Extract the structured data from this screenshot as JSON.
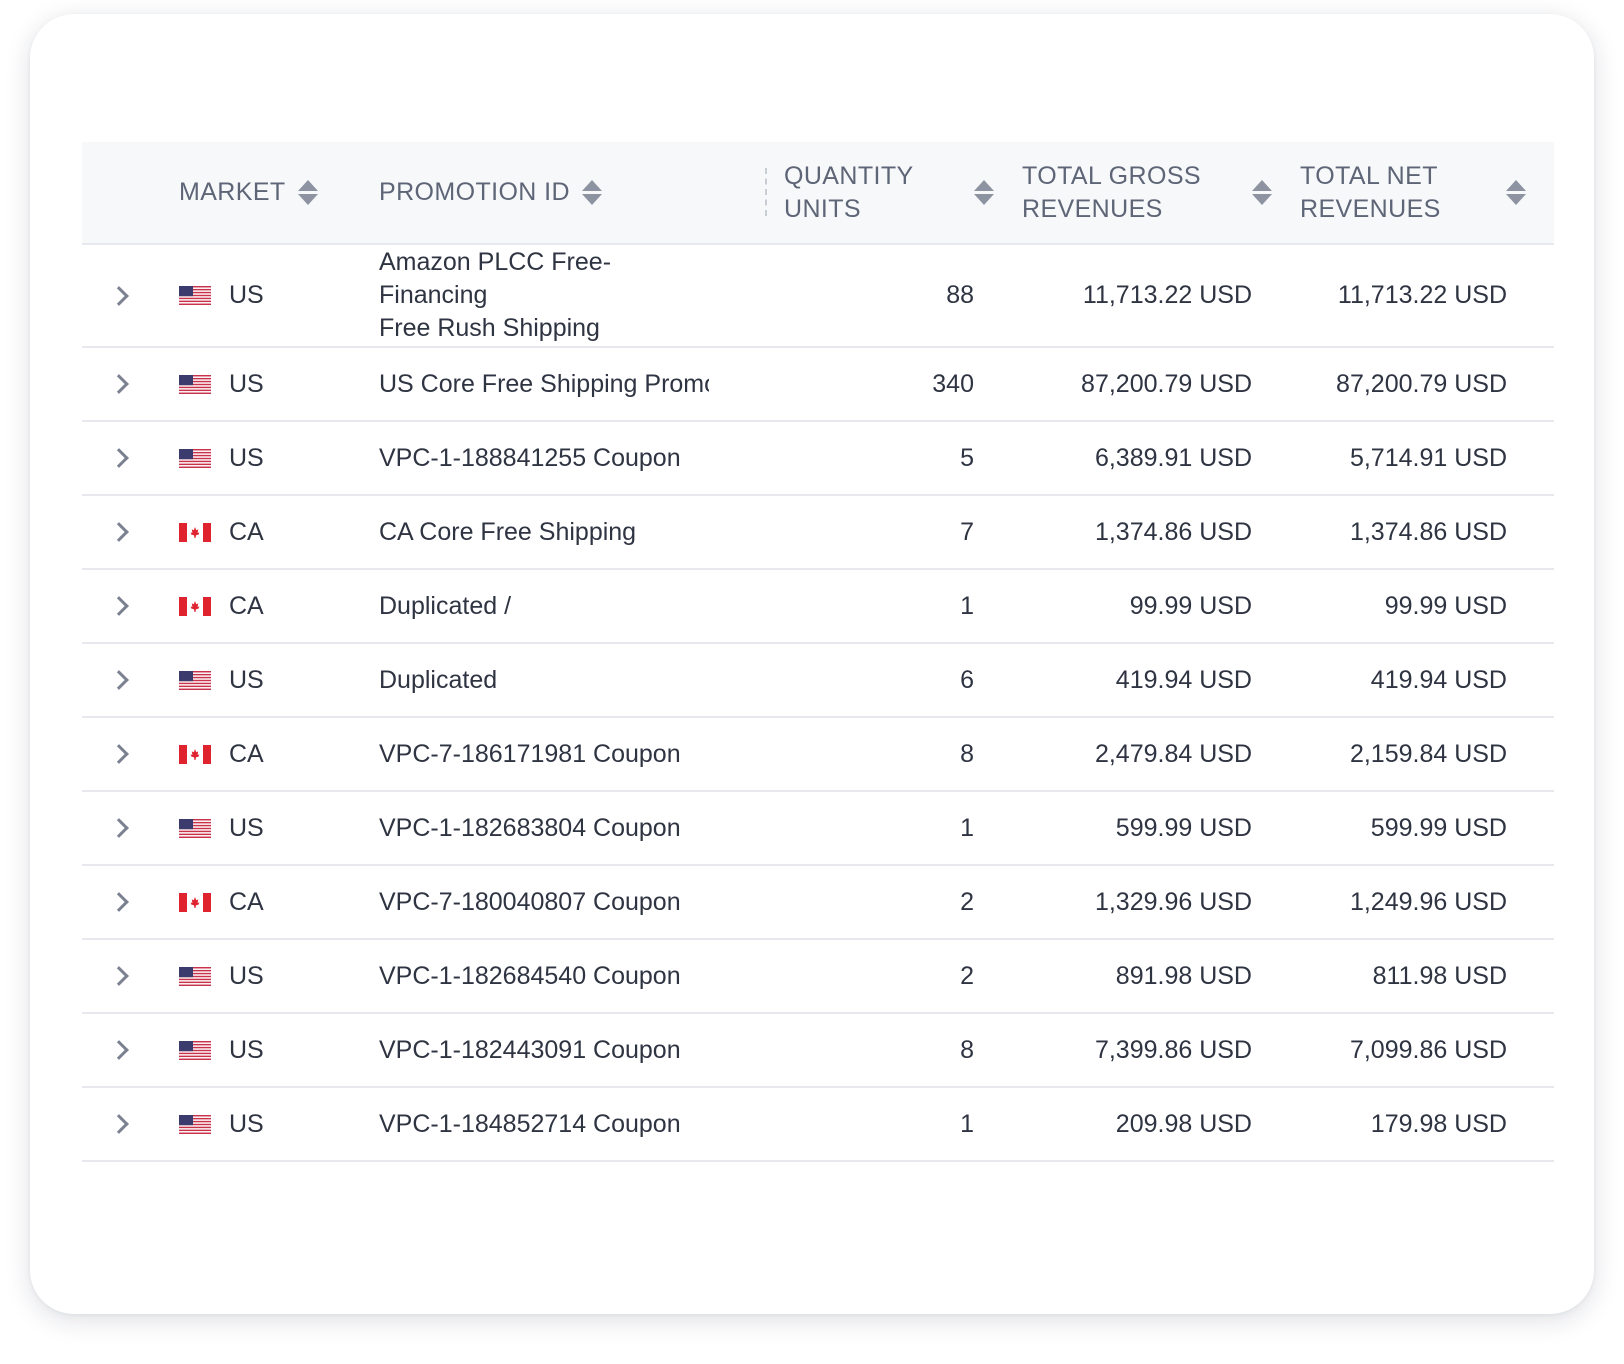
{
  "table": {
    "headers": {
      "market": "MARKET",
      "promotion_id": "PROMOTION ID",
      "quantity_line1": "QUANTITY",
      "quantity_line2": "UNITS",
      "gross_line1": "TOTAL GROSS",
      "gross_line2": "REVENUES",
      "net_line1": "TOTAL NET",
      "net_line2": "REVENUES"
    },
    "rows": [
      {
        "market": "US",
        "flag": "us-flag-icon",
        "promo_line1": "Amazon PLCC Free-Financing",
        "promo_line2": "Free Rush Shipping",
        "qty": "88",
        "gross": "11,713.22 USD",
        "net": "11,713.22 USD"
      },
      {
        "market": "US",
        "flag": "us-flag-icon",
        "promo_line1": "US Core Free Shipping Promo",
        "qty": "340",
        "gross": "87,200.79 USD",
        "net": "87,200.79 USD"
      },
      {
        "market": "US",
        "flag": "us-flag-icon",
        "promo_line1": "VPC-1-188841255 Coupon",
        "qty": "5",
        "gross": "6,389.91 USD",
        "net": "5,714.91 USD"
      },
      {
        "market": "CA",
        "flag": "ca-flag-icon",
        "promo_line1": "CA Core Free Shipping",
        "qty": "7",
        "gross": "1,374.86 USD",
        "net": "1,374.86 USD"
      },
      {
        "market": "CA",
        "flag": "ca-flag-icon",
        "promo_line1": "Duplicated /",
        "qty": "1",
        "gross": "99.99 USD",
        "net": "99.99 USD"
      },
      {
        "market": "US",
        "flag": "us-flag-icon",
        "promo_line1": "Duplicated",
        "qty": "6",
        "gross": "419.94 USD",
        "net": "419.94 USD"
      },
      {
        "market": "CA",
        "flag": "ca-flag-icon",
        "promo_line1": "VPC-7-186171981 Coupon",
        "qty": "8",
        "gross": "2,479.84 USD",
        "net": "2,159.84 USD"
      },
      {
        "market": "US",
        "flag": "us-flag-icon",
        "promo_line1": "VPC-1-182683804 Coupon",
        "qty": "1",
        "gross": "599.99 USD",
        "net": "599.99 USD"
      },
      {
        "market": "CA",
        "flag": "ca-flag-icon",
        "promo_line1": "VPC-7-180040807 Coupon",
        "qty": "2",
        "gross": "1,329.96 USD",
        "net": "1,249.96 USD"
      },
      {
        "market": "US",
        "flag": "us-flag-icon",
        "promo_line1": "VPC-1-182684540 Coupon",
        "qty": "2",
        "gross": "891.98 USD",
        "net": "811.98 USD"
      },
      {
        "market": "US",
        "flag": "us-flag-icon",
        "promo_line1": "VPC-1-182443091 Coupon",
        "qty": "8",
        "gross": "7,399.86 USD",
        "net": "7,099.86 USD"
      },
      {
        "market": "US",
        "flag": "us-flag-icon",
        "promo_line1": "VPC-1-184852714 Coupon",
        "qty": "1",
        "gross": "209.98 USD",
        "net": "179.98 USD"
      }
    ]
  }
}
